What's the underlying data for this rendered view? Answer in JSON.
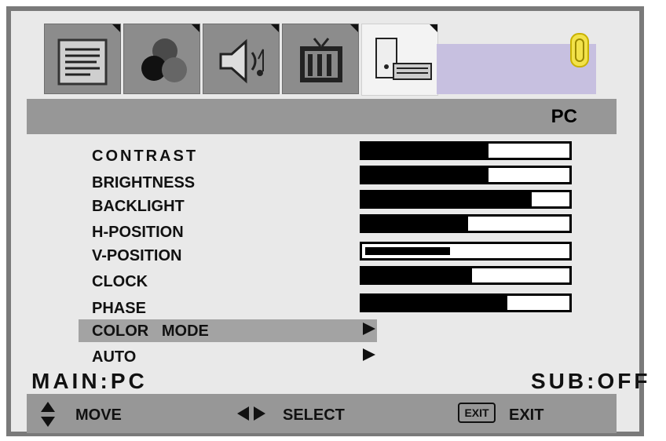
{
  "header": {
    "title": "PC"
  },
  "tabs": [
    {
      "name": "picture",
      "icon": "document-icon"
    },
    {
      "name": "color",
      "icon": "color-balls-icon"
    },
    {
      "name": "sound",
      "icon": "speaker-icon"
    },
    {
      "name": "tv",
      "icon": "tv-icon"
    },
    {
      "name": "pc",
      "icon": "computer-icon",
      "active": true
    }
  ],
  "menu": {
    "contrast": {
      "label": "CONTRAST",
      "level": 0.61
    },
    "brightness": {
      "label": "BRIGHTNESS",
      "level": 0.61
    },
    "backlight": {
      "label": "BACKLIGHT",
      "level": 0.82
    },
    "h_position": {
      "label": "H-POSITION",
      "level": 0.51
    },
    "v_position": {
      "label": "V-POSITION",
      "level": 0.41
    },
    "clock": {
      "label": "CLOCK",
      "level": 0.53
    },
    "phase": {
      "label": "PHASE",
      "level": 0.7
    },
    "color_mode": {
      "label": "COLOR   MODE"
    },
    "auto": {
      "label": "AUTO"
    }
  },
  "status": {
    "main": "MAIN:PC",
    "sub": "SUB:OFF"
  },
  "footer": {
    "move": "MOVE",
    "select": "SELECT",
    "exit_key": "EXIT",
    "exit": "EXIT"
  },
  "colors": {
    "frame": "#7a7a7a",
    "panel": "#e9e9e9",
    "bar": "#979797",
    "highlight": "#a3a3a3",
    "accent": "#c7c0e0"
  }
}
